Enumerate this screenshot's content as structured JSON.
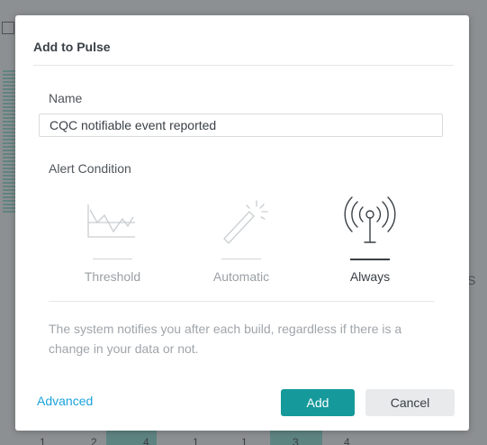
{
  "dialog": {
    "title": "Add to Pulse",
    "name_label": "Name",
    "name_value": "CQC notifiable event reported",
    "alert_condition_label": "Alert Condition",
    "options": [
      {
        "label": "Threshold",
        "icon": "threshold-chart-icon",
        "selected": false
      },
      {
        "label": "Automatic",
        "icon": "magic-wand-icon",
        "selected": false
      },
      {
        "label": "Always",
        "icon": "broadcast-antenna-icon",
        "selected": true
      }
    ],
    "description": "The system notifies you after each build, regardless if there is a change in your data or not.",
    "advanced_label": "Advanced",
    "add_label": "Add",
    "cancel_label": "Cancel"
  },
  "background": {
    "right_edge_text": "S",
    "footer_numbers": [
      "1",
      "2",
      "4",
      "1",
      "1",
      "3",
      "4"
    ]
  },
  "colors": {
    "accent": "#16999a",
    "link": "#1aa3dc",
    "overlay": "#8d9092"
  }
}
